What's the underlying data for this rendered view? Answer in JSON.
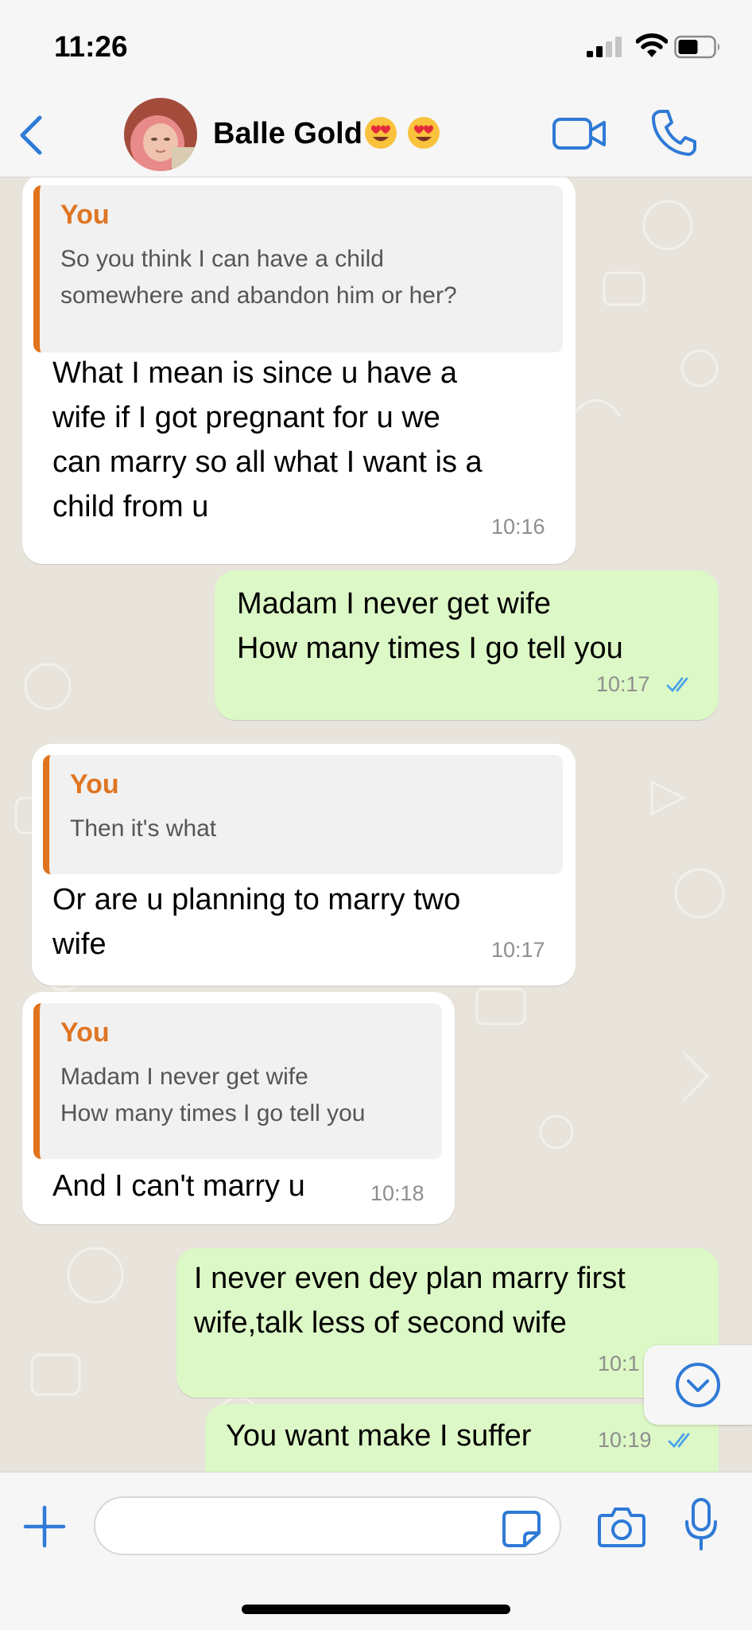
{
  "status_bar": {
    "time": "11:26"
  },
  "header": {
    "contact_name": "Balle Gold",
    "emoji": [
      "smiling-face-with-heart-eyes",
      "smiling-face-with-heart-eyes"
    ]
  },
  "messages": [
    {
      "direction": "incoming",
      "reply_author": "You",
      "reply_text": "So you think I can have a child\nsomewhere and abandon him or her?",
      "text": "What I mean is since u have a\nwife if I got pregnant for u we\ncan marry so all what I want is a\nchild from u",
      "time": "10:16"
    },
    {
      "direction": "outgoing",
      "text": "Madam I never get wife\nHow many times I go tell you",
      "time": "10:17",
      "status": "read"
    },
    {
      "direction": "incoming",
      "reply_author": "You",
      "reply_text": "Then it's what",
      "text": "Or are u planning to marry two\nwife",
      "time": "10:17"
    },
    {
      "direction": "incoming",
      "reply_author": "You",
      "reply_text": "Madam I never get wife\nHow many times I go tell you",
      "text": "And I can't marry u",
      "time": "10:18"
    },
    {
      "direction": "outgoing",
      "text": "I never even dey plan marry first\nwife,talk less of second wife",
      "time": "10:1",
      "status": "read"
    },
    {
      "direction": "outgoing",
      "text": "You want make I suffer",
      "time": "10:19",
      "status": "read"
    }
  ],
  "colors": {
    "accent": "#2f7ad6",
    "outgoing_bubble": "#dcf8c6",
    "incoming_bubble": "#ffffff",
    "quote_accent": "#e0731e",
    "read_ticks": "#4aa3e8"
  },
  "icons": [
    "back-chevron-icon",
    "video-call-icon",
    "phone-icon",
    "scroll-down-icon",
    "plus-icon",
    "sticker-icon",
    "camera-icon",
    "microphone-icon"
  ],
  "composer": {
    "value": ""
  }
}
